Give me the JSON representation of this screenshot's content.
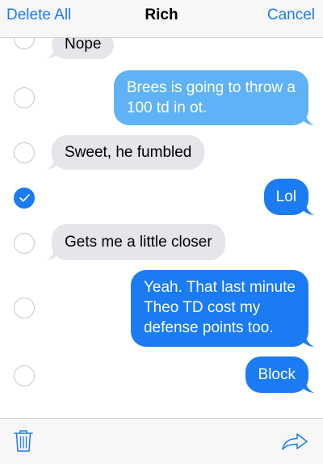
{
  "nav": {
    "left_label": "Delete All",
    "title": "Rich",
    "right_label": "Cancel"
  },
  "messages": [
    {
      "side": "in",
      "checked": false,
      "lines": [
        "Nope"
      ]
    },
    {
      "side": "out",
      "checked": false,
      "lines": [
        "Brees is going to throw a",
        "100 td in ot."
      ]
    },
    {
      "side": "in",
      "checked": false,
      "lines": [
        "Sweet, he fumbled"
      ]
    },
    {
      "side": "out",
      "checked": true,
      "lines": [
        "Lol"
      ]
    },
    {
      "side": "in",
      "checked": false,
      "lines": [
        "Gets me a little closer"
      ]
    },
    {
      "side": "out",
      "checked": false,
      "lines": [
        "Yeah. That last minute",
        "Theo TD cost my",
        "defense points too."
      ]
    },
    {
      "side": "out",
      "checked": false,
      "lines": [
        "Block"
      ]
    }
  ],
  "toolbar": {
    "left_icon": "trash-icon",
    "right_icon": "forward-arrow-icon"
  },
  "colors": {
    "accent": "#1a7bf2",
    "incoming_bubble": "#e5e5ea",
    "outgoing_bubble": "#1a7bf2",
    "outgoing_bubble_light": "#5fb2f5"
  }
}
